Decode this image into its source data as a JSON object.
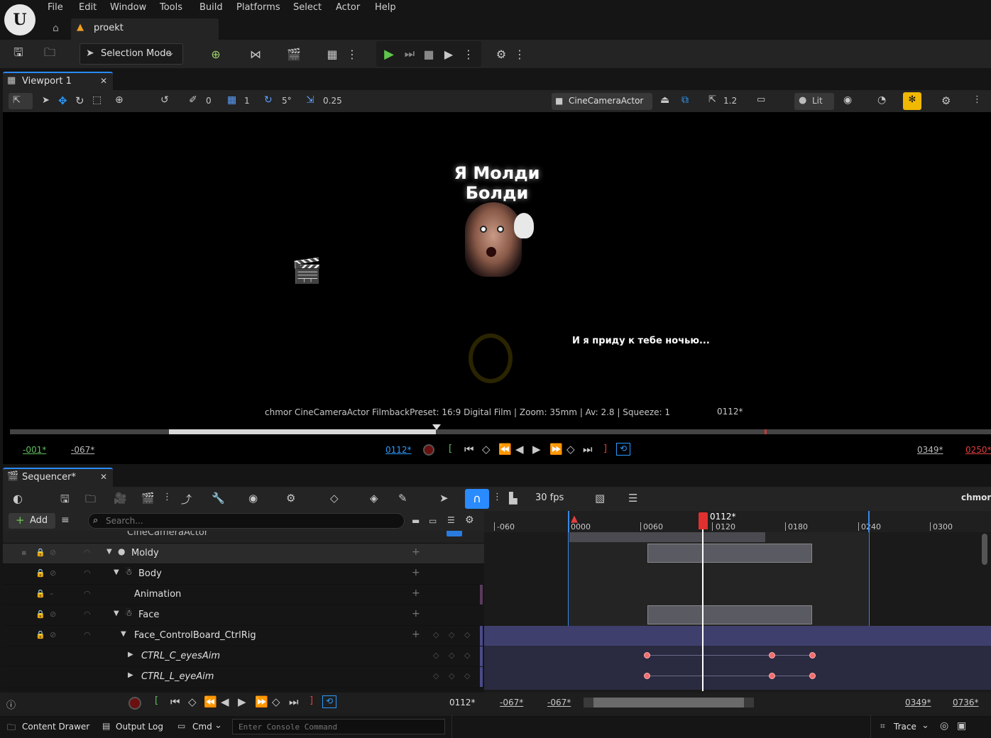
{
  "menu": {
    "file": "File",
    "edit": "Edit",
    "window": "Window",
    "tools": "Tools",
    "build": "Build",
    "platforms": "Platforms",
    "select": "Select",
    "actor": "Actor",
    "help": "Help"
  },
  "project_tab": "proekt",
  "toolbar": {
    "selection_mode": "Selection Mode"
  },
  "viewport": {
    "tab": "Viewport 1",
    "snap_translate": "0",
    "grid": "1",
    "rotate_snap": "5°",
    "scale_snap": "0.25",
    "camera": "CineCameraActor",
    "speed": "1.2",
    "view_mode": "Lit",
    "title_text": "Я Молди Болди",
    "subtitle_text": "И я приду к тебе ночью...",
    "info": "chmor  CineCameraActor FilmbackPreset: 16:9 Digital Film | Zoom: 35mm | Av: 2.8 | Squeeze: 1",
    "frame": "0112*",
    "playback": {
      "start": "-001*",
      "view_start": "-067*",
      "current": "0112*",
      "view_end": "0349*",
      "end": "0250*"
    }
  },
  "sequencer": {
    "tab": "Sequencer*",
    "fps": "30 fps",
    "sequence_name": "chmor*",
    "add_label": "Add",
    "search_placeholder": "Search...",
    "current_frame": "0112*",
    "ruler_labels": [
      "-060",
      "0000",
      "0060",
      "0120",
      "0180",
      "0240",
      "0300"
    ],
    "tracks": [
      {
        "label": "CineCameraActor"
      },
      {
        "label": "Moldy"
      },
      {
        "label": "Body"
      },
      {
        "label": "Animation"
      },
      {
        "label": "Face"
      },
      {
        "label": "Face_ControlBoard_CtrlRig"
      },
      {
        "label": "CTRL_C_eyesAim"
      },
      {
        "label": "CTRL_L_eyeAim"
      }
    ],
    "bottom": {
      "current": "0112*",
      "a": "-067*",
      "b": "-067*",
      "c": "0349*",
      "d": "0736*"
    }
  },
  "status": {
    "content_drawer": "Content Drawer",
    "output_log": "Output Log",
    "cmd": "Cmd",
    "console_placeholder": "Enter Console Command",
    "trace": "Trace"
  }
}
